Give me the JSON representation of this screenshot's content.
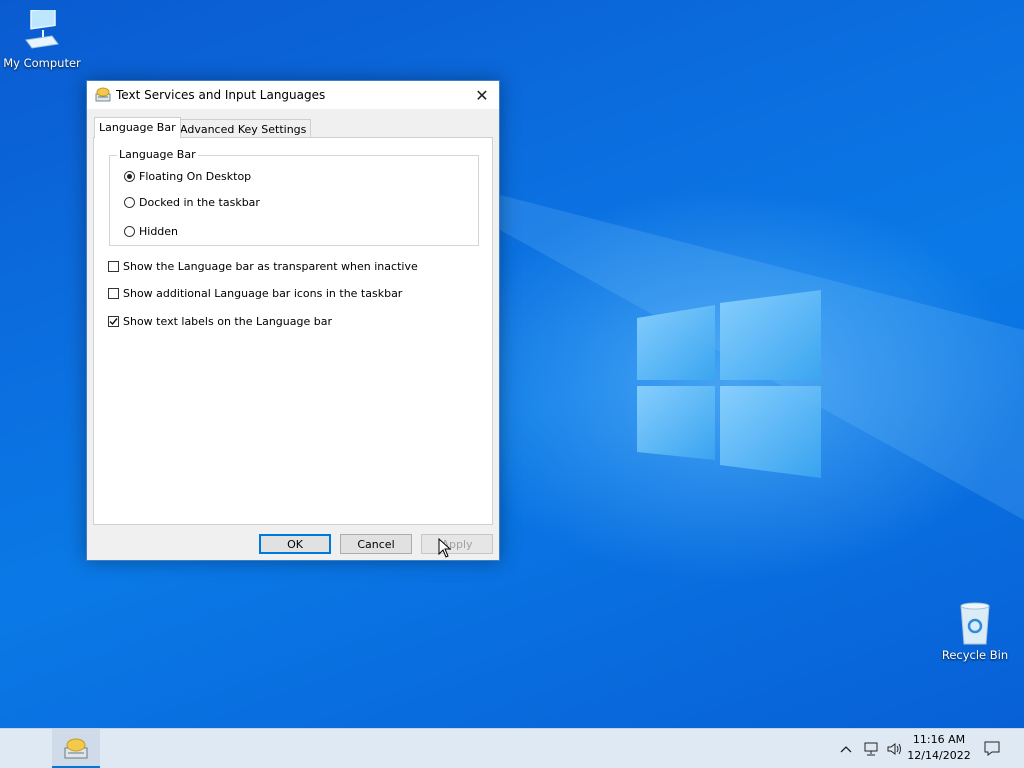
{
  "desktop": {
    "icons": [
      {
        "label": "My Computer",
        "icon": "computer-icon"
      },
      {
        "label": "Recycle Bin",
        "icon": "recycle-bin-icon"
      }
    ]
  },
  "dialog": {
    "title": "Text Services and Input Languages",
    "title_icon": "keyboard-input-icon",
    "close_symbol": "✕",
    "tabs": [
      {
        "label": "Language Bar",
        "active": true
      },
      {
        "label": "Advanced Key Settings",
        "active": false
      }
    ],
    "group_label": "Language Bar",
    "radios": [
      {
        "label": "Floating On Desktop",
        "checked": true
      },
      {
        "label": "Docked in the taskbar",
        "checked": false
      },
      {
        "label": "Hidden",
        "checked": false
      }
    ],
    "checkboxes": [
      {
        "label": "Show the Language bar as transparent when inactive",
        "checked": false
      },
      {
        "label": "Show additional Language bar icons in the taskbar",
        "checked": false
      },
      {
        "label": "Show text labels on the Language bar",
        "checked": true
      }
    ],
    "buttons": {
      "ok": "OK",
      "cancel": "Cancel",
      "apply": "Apply"
    }
  },
  "taskbar": {
    "app_icon": "keyboard-input-icon",
    "tray_icons": [
      "chevron-up-icon",
      "network-icon",
      "volume-icon"
    ],
    "time": "11:16 AM",
    "date": "12/14/2022",
    "notification_icon": "notification-icon"
  },
  "colors": {
    "desktop": "#0a6ee0",
    "accent": "#0078d7",
    "taskbar": "#dfe9f4"
  }
}
